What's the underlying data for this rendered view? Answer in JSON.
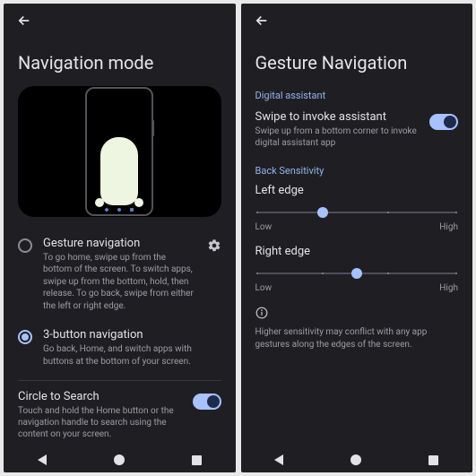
{
  "left": {
    "title": "Navigation mode",
    "options": [
      {
        "label": "Gesture navigation",
        "desc": "To go home, swipe up from the bottom of the screen. To switch apps, swipe up from the bottom, hold, then release. To go back, swipe from either the left or right edge.",
        "checked": false,
        "gear": true
      },
      {
        "label": "3-button navigation",
        "desc": "Go back, Home, and switch apps with buttons at the bottom of your screen.",
        "checked": true,
        "gear": false
      }
    ],
    "circle": {
      "title": "Circle to Search",
      "desc": "Touch and hold the Home button or the navigation handle to search using the content on your screen.",
      "on": true
    }
  },
  "right": {
    "title": "Gesture Navigation",
    "sections": {
      "assistant_label": "Digital assistant",
      "assistant": {
        "title": "Swipe to invoke assistant",
        "desc": "Swipe up from a bottom corner to invoke digital assistant app",
        "on": true
      },
      "back_label": "Back Sensitivity",
      "left_edge": {
        "title": "Left edge",
        "low": "Low",
        "high": "High",
        "pos": 33
      },
      "right_edge": {
        "title": "Right edge",
        "low": "Low",
        "high": "High",
        "pos": 50
      },
      "info": "Higher sensitivity may conflict with any app gestures along the edges of the screen."
    }
  }
}
